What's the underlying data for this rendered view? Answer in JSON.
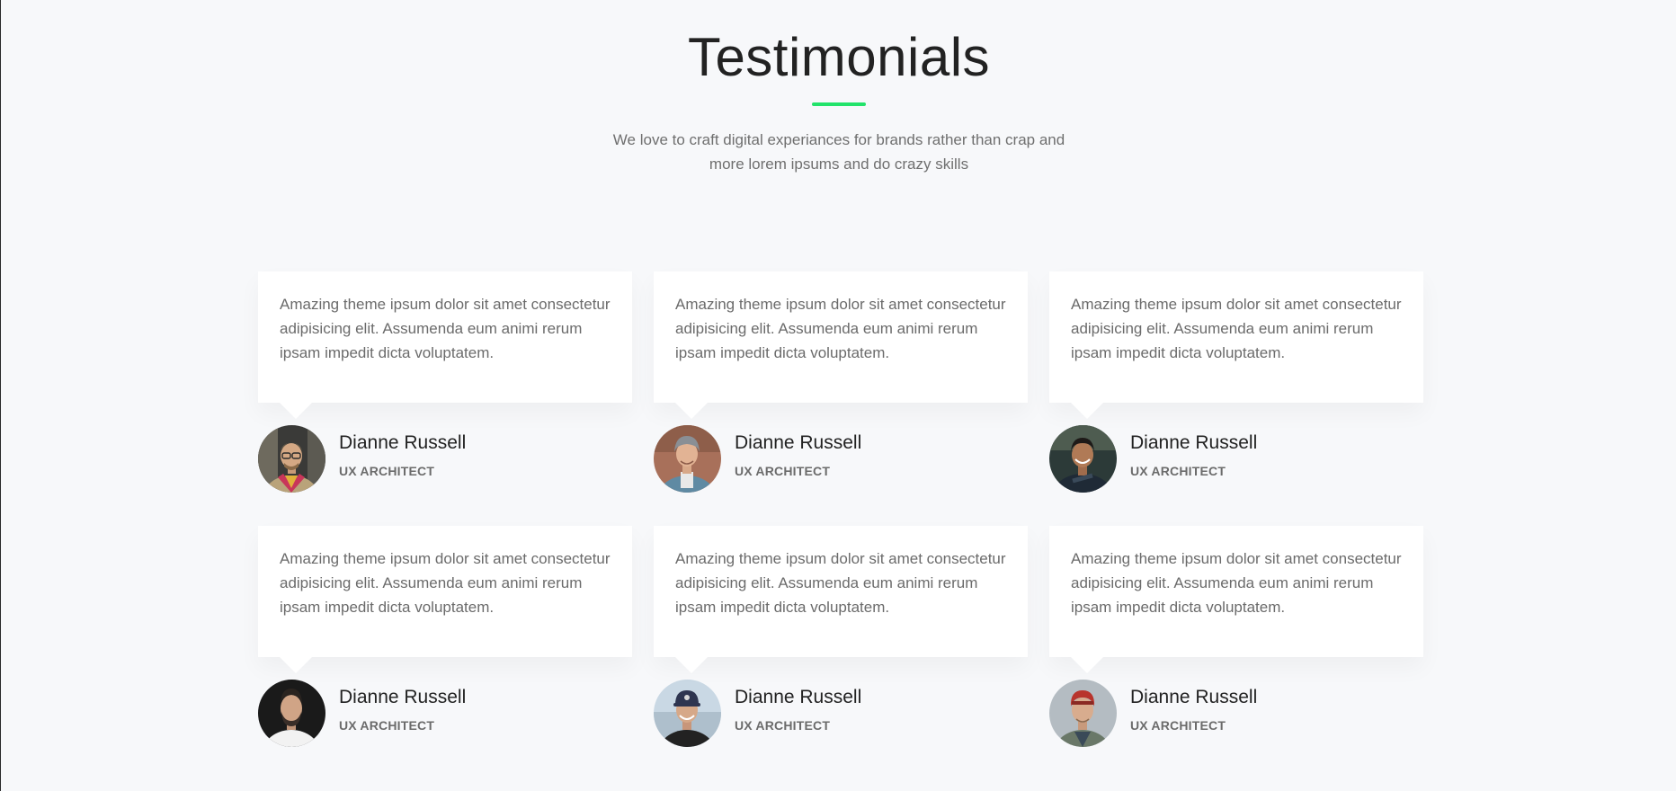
{
  "section": {
    "title": "Testimonials",
    "subtitle": "We love to craft digital experiances for brands rather than crap and more lorem ipsums and do crazy skills",
    "accent_color": "#22e36a"
  },
  "testimonials": [
    {
      "quote": "Amazing theme ipsum dolor sit amet consectetur adipisicing elit. Assumenda eum animi rerum ipsam impedit dicta voluptatem.",
      "name": "Dianne Russell",
      "role": "UX ARCHITECT",
      "avatar": "avatar-photo-man-glasses-scarf"
    },
    {
      "quote": "Amazing theme ipsum dolor sit amet consectetur adipisicing elit. Assumenda eum animi rerum ipsam impedit dicta voluptatem.",
      "name": "Dianne Russell",
      "role": "UX ARCHITECT",
      "avatar": "avatar-photo-man-beanie"
    },
    {
      "quote": "Amazing theme ipsum dolor sit amet consectetur adipisicing elit. Assumenda eum animi rerum ipsam impedit dicta voluptatem.",
      "name": "Dianne Russell",
      "role": "UX ARCHITECT",
      "avatar": "avatar-photo-man-smiling-dark"
    },
    {
      "quote": "Amazing theme ipsum dolor sit amet consectetur adipisicing elit. Assumenda eum animi rerum ipsam impedit dicta voluptatem.",
      "name": "Dianne Russell",
      "role": "UX ARCHITECT",
      "avatar": "avatar-photo-man-beard-white-shirt"
    },
    {
      "quote": "Amazing theme ipsum dolor sit amet consectetur adipisicing elit. Assumenda eum animi rerum ipsam impedit dicta voluptatem.",
      "name": "Dianne Russell",
      "role": "UX ARCHITECT",
      "avatar": "avatar-photo-man-cap"
    },
    {
      "quote": "Amazing theme ipsum dolor sit amet consectetur adipisicing elit. Assumenda eum animi rerum ipsam impedit dicta voluptatem.",
      "name": "Dianne Russell",
      "role": "UX ARCHITECT",
      "avatar": "avatar-photo-man-red-cap"
    }
  ]
}
